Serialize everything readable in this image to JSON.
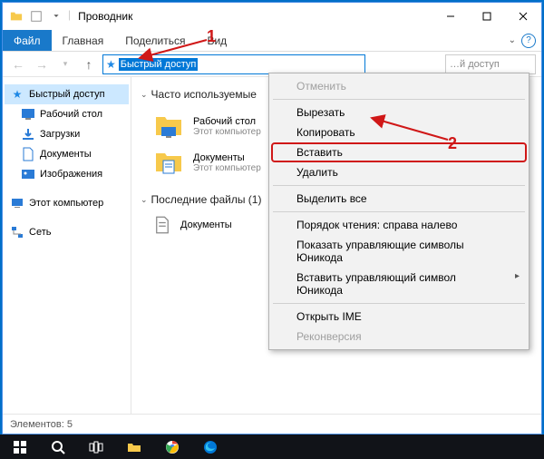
{
  "title": "Проводник",
  "ribbon": {
    "file": "Файл",
    "tabs": [
      "Главная",
      "Поделиться",
      "Вид"
    ]
  },
  "addressbar": {
    "value": "Быстрый доступ"
  },
  "search": {
    "placeholder": "…й доступ"
  },
  "nav": {
    "quickaccess": "Быстрый доступ",
    "items": [
      {
        "label": "Рабочий стол",
        "icon": "desktop"
      },
      {
        "label": "Загрузки",
        "icon": "downloads"
      },
      {
        "label": "Документы",
        "icon": "documents"
      },
      {
        "label": "Изображения",
        "icon": "pictures"
      }
    ],
    "thispc": "Этот компьютер",
    "network": "Сеть"
  },
  "content": {
    "group1": "Часто используемые",
    "group2": "Последние файлы (1)",
    "items": [
      {
        "name": "Рабочий стол",
        "sub": "Этот компьютер"
      },
      {
        "name": "Документы",
        "sub": "Этот компьютер"
      }
    ],
    "recent": [
      {
        "name": "Документы"
      }
    ]
  },
  "contextmenu": {
    "undo": "Отменить",
    "cut": "Вырезать",
    "copy": "Копировать",
    "paste": "Вставить",
    "delete": "Удалить",
    "selectall": "Выделить все",
    "rtl": "Порядок чтения: справа налево",
    "showctrl": "Показать управляющие символы Юникода",
    "insertctrl": "Вставить управляющий символ Юникода",
    "openime": "Открыть IME",
    "reconvert": "Реконверсия"
  },
  "statusbar": {
    "text": "Элементов: 5"
  },
  "annotations": {
    "one": "1",
    "two": "2"
  }
}
